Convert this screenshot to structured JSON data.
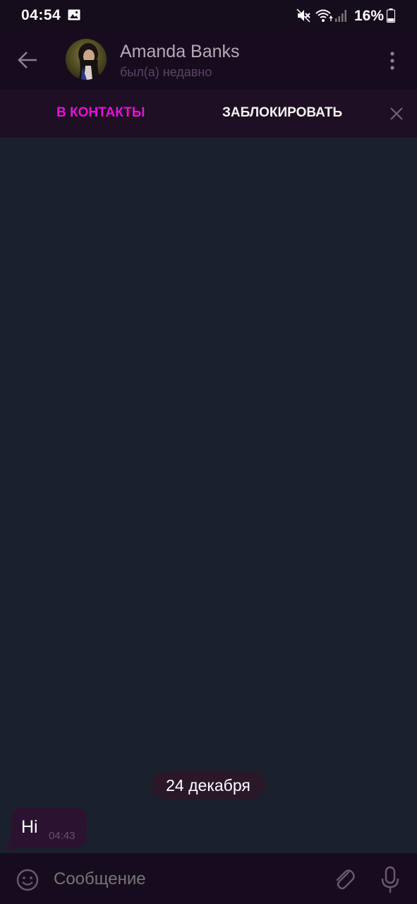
{
  "status_bar": {
    "time": "04:54",
    "battery_percent": "16%",
    "icons": [
      "gallery-icon",
      "mute-icon",
      "wifi-icon",
      "signal-icon",
      "battery-icon"
    ]
  },
  "header": {
    "contact_name": "Amanda Banks",
    "last_seen": "был(а) недавно",
    "icons": [
      "back-arrow-icon",
      "more-vertical-icon"
    ]
  },
  "action_bar": {
    "add_contact_label": "В КОНТАКТЫ",
    "block_label": "ЗАБЛОКИРОВАТЬ",
    "close_icon": "close-icon"
  },
  "chat": {
    "date_label": "24 декабря",
    "messages": [
      {
        "text": "Hi",
        "time": "04:43"
      }
    ]
  },
  "composer": {
    "placeholder": "Сообщение",
    "icons": [
      "emoji-icon",
      "attach-icon",
      "mic-icon"
    ]
  },
  "colors": {
    "accent": "#e312d7",
    "background": "#1b212c",
    "header_bg": "#170c1d",
    "bubble_bg": "#2b1231"
  }
}
